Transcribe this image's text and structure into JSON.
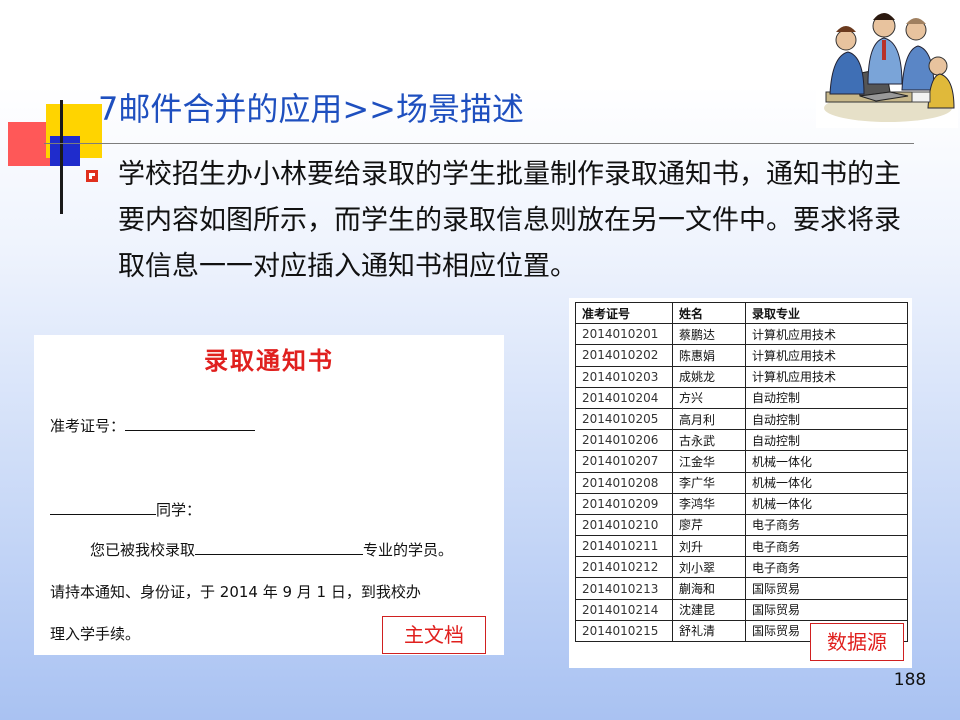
{
  "slide": {
    "title": "7邮件合并的应用>>场景描述",
    "paragraph": "学校招生办小林要给录取的学生批量制作录取通知书，通知书的主要内容如图所示，而学生的录取信息则放在另一文件中。要求将录取信息一一对应插入通知书相应位置。",
    "page_number": "188"
  },
  "notice": {
    "title": "录取通知书",
    "exam_no_label": "准考证号：",
    "student_suffix": "同学：",
    "admitted_prefix": "您已被我校录取",
    "admitted_suffix": "专业的学员。",
    "instructions_1": "请持本通知、身份证，于 2014 年 9 月 1 日，到我校办",
    "instructions_2": "理入学手续。",
    "label": "主文档"
  },
  "datasource": {
    "label": "数据源",
    "columns": [
      "准考证号",
      "姓名",
      "录取专业"
    ],
    "rows": [
      [
        "2014010201",
        "蔡鹏达",
        "计算机应用技术"
      ],
      [
        "2014010202",
        "陈惠娟",
        "计算机应用技术"
      ],
      [
        "2014010203",
        "成姚龙",
        "计算机应用技术"
      ],
      [
        "2014010204",
        "方兴",
        "自动控制"
      ],
      [
        "2014010205",
        "高月利",
        "自动控制"
      ],
      [
        "2014010206",
        "古永武",
        "自动控制"
      ],
      [
        "2014010207",
        "江金华",
        "机械一体化"
      ],
      [
        "2014010208",
        "李广华",
        "机械一体化"
      ],
      [
        "2014010209",
        "李鸿华",
        "机械一体化"
      ],
      [
        "2014010210",
        "廖芹",
        "电子商务"
      ],
      [
        "2014010211",
        "刘升",
        "电子商务"
      ],
      [
        "2014010212",
        "刘小翠",
        "电子商务"
      ],
      [
        "2014010213",
        "蒯海和",
        "国际贸易"
      ],
      [
        "2014010214",
        "沈建昆",
        "国际贸易"
      ],
      [
        "2014010215",
        "舒礼清",
        "国际贸易"
      ]
    ]
  },
  "colors": {
    "title": "#1e4fbf",
    "accent_red": "#e0201e",
    "bullet": "#e0301e"
  },
  "icons": [
    "team-meeting-clipart",
    "square-bullet-icon"
  ]
}
